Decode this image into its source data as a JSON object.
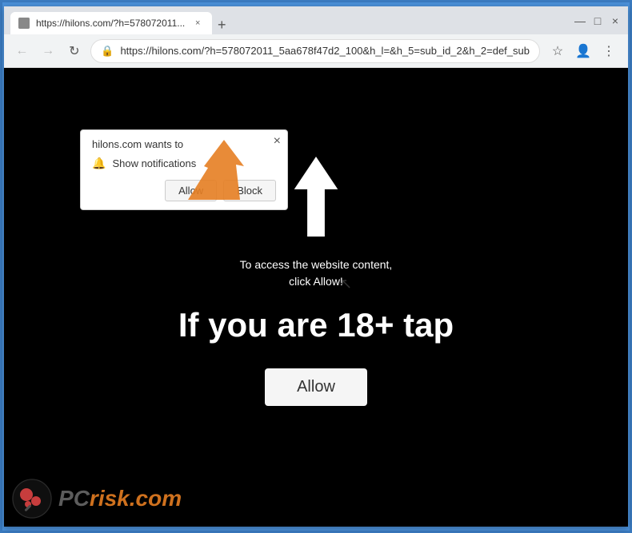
{
  "browser": {
    "tab": {
      "favicon": "page-icon",
      "title": "https://hilons.com/?h=578072011...",
      "close_label": "×"
    },
    "new_tab_label": "+",
    "window_controls": {
      "minimize": "—",
      "maximize": "□",
      "close": "×"
    },
    "nav": {
      "back_label": "←",
      "forward_label": "→",
      "reload_label": "↻",
      "address": "https://hilons.com/?h=578072011_5aa678f47d2_100&h_l=&h_5=sub_id_2&h_2=def_sub",
      "lock_icon": "🔒",
      "star_label": "☆",
      "account_label": "👤",
      "menu_label": "⋮"
    }
  },
  "popup": {
    "title": "hilons.com wants to",
    "close_label": "×",
    "notification_label": "Show notifications",
    "allow_label": "Allow",
    "block_label": "Block"
  },
  "content": {
    "small_text_line1": "To access the website content,",
    "small_text_line2": "click Allow!",
    "large_text": "If you are 18+ tap",
    "allow_button_label": "Allow"
  },
  "watermark": {
    "text_pc": "PC",
    "text_risk": "risk.com"
  },
  "colors": {
    "accent_orange": "#e67e22",
    "background_dark": "#000000",
    "browser_bg": "#dee1e6"
  }
}
